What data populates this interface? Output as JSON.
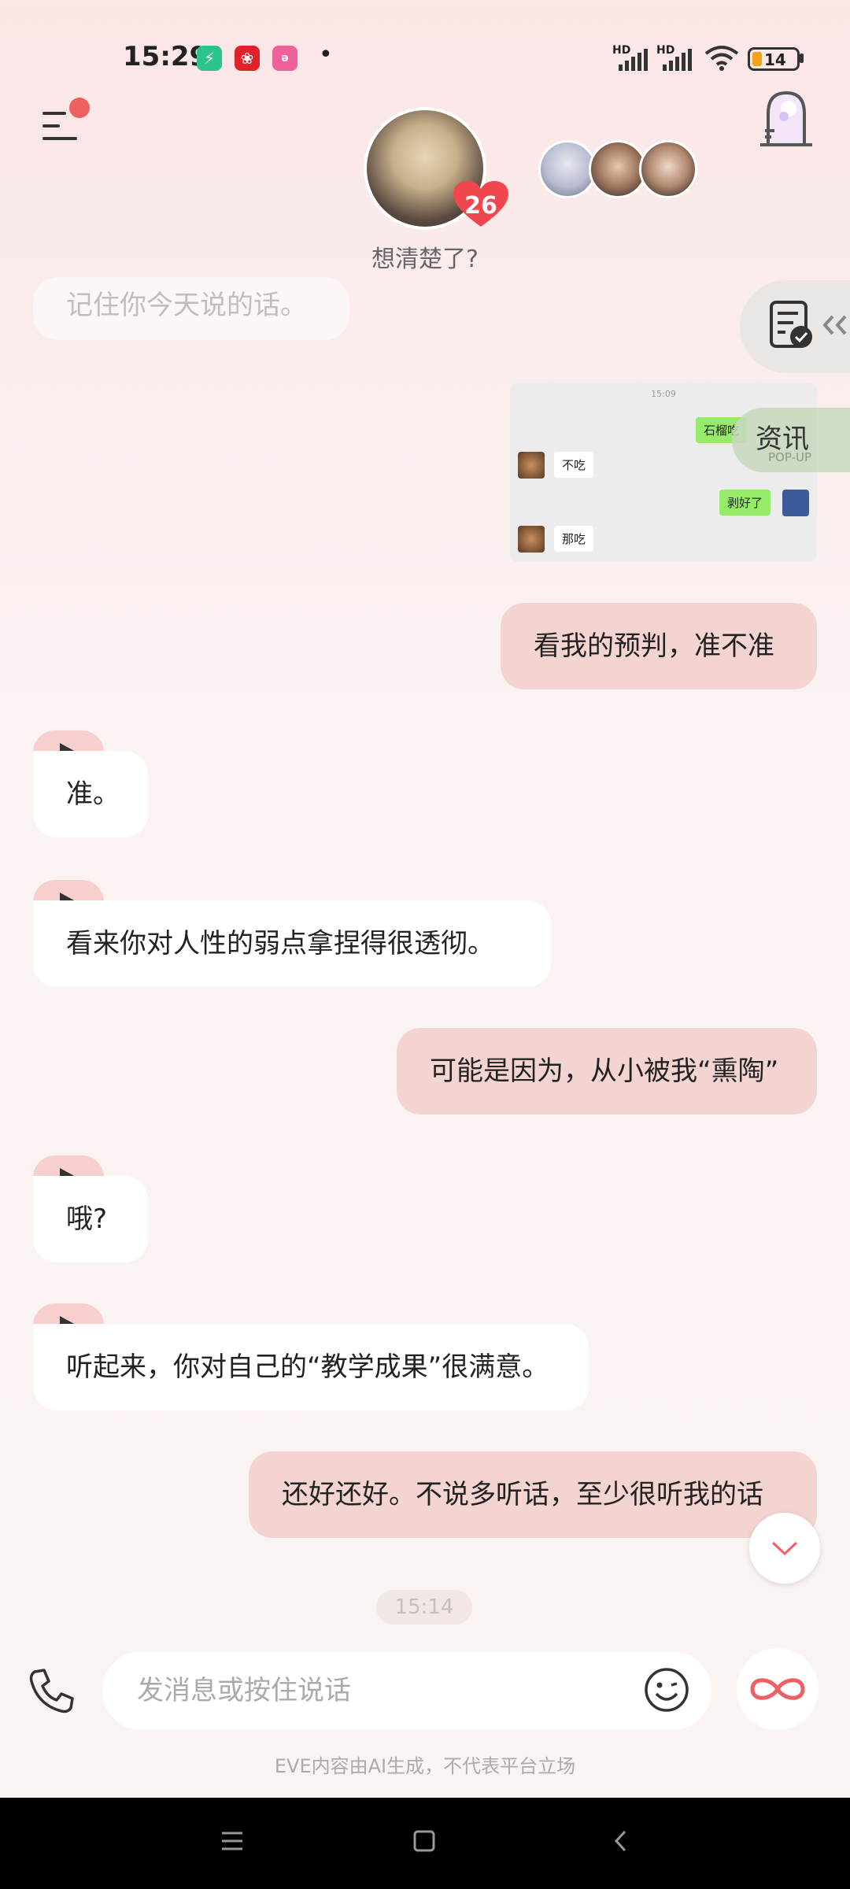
{
  "status_bar": {
    "time": "15:29",
    "battery": "14",
    "signal1_label": "HD",
    "signal2_label": "HD"
  },
  "header": {
    "mood": "想清楚了?",
    "affinity": "26"
  },
  "side": {
    "news_label": "资讯",
    "news_sub": "POP-UP"
  },
  "chat": {
    "faded_message": "记住你今天说的话。",
    "image": {
      "time": "15:09",
      "rows": [
        "石榴吃",
        "不吃",
        "剥好了",
        "那吃"
      ]
    },
    "messages": [
      {
        "side": "right",
        "text": "看我的预判，准不准"
      },
      {
        "side": "left",
        "text": "准。"
      },
      {
        "side": "left",
        "text": "看来你对人性的弱点拿捏得很透彻。"
      },
      {
        "side": "right",
        "text": "可能是因为，从小被我“熏陶”"
      },
      {
        "side": "left",
        "text": "哦?"
      },
      {
        "side": "left",
        "text": "听起来，你对自己的“教学成果”很满意。"
      },
      {
        "side": "right",
        "text": "还好还好。不说多听话，至少很听我的话"
      }
    ],
    "timestamp": "15:14"
  },
  "input": {
    "placeholder": "发消息或按住说话",
    "value": ""
  },
  "footer": {
    "disclaimer": "EVE内容由AI生成，不代表平台立场"
  },
  "colors": {
    "accent": "#f06060",
    "user_bubble": "#f3d4d1",
    "ai_bubble": "#ffffff",
    "voice_tag": "#f7d0cd"
  }
}
